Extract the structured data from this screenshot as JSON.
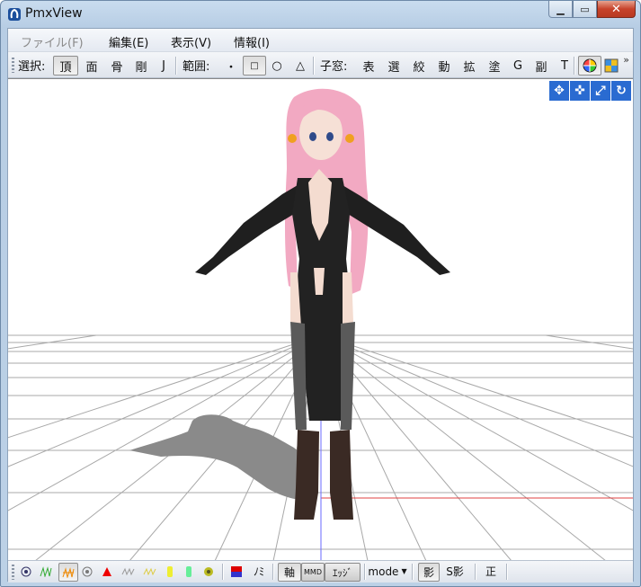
{
  "window": {
    "title": "PmxView"
  },
  "menu": [
    {
      "label": "ファイル(F)",
      "enabled": false
    },
    {
      "label": "編集(E)",
      "enabled": true
    },
    {
      "label": "表示(V)",
      "enabled": true
    },
    {
      "label": "情報(I)",
      "enabled": true
    }
  ],
  "toolbar": {
    "select_label": "選択:",
    "select_items": [
      "頂",
      "面",
      "骨",
      "剛",
      "J"
    ],
    "select_active": "頂",
    "range_label": "範囲:",
    "range_items": [
      "・",
      "□",
      "○",
      "△"
    ],
    "range_active": "□",
    "child_label": "子窓:",
    "child_items": [
      "表",
      "選",
      "絞",
      "動",
      "拡",
      "塗",
      "G",
      "副",
      "T"
    ],
    "overflow": "»"
  },
  "viewport_icons": [
    "move-xy-icon",
    "move-xz-icon",
    "move-z-icon",
    "rotate-icon"
  ],
  "bottombar": {
    "label_nomi": "ﾉﾐ",
    "axis": "軸",
    "mmd": "MMD",
    "edge": "ｴｯｼﾞ",
    "mode": "mode",
    "shadow": "影",
    "sshadow": "S影",
    "front": "正"
  },
  "colors": {
    "accent_blue": "#2a6bd1",
    "grid": "#9a9a9a",
    "x_axis": "#e04040",
    "z_axis": "#6a6aff"
  }
}
